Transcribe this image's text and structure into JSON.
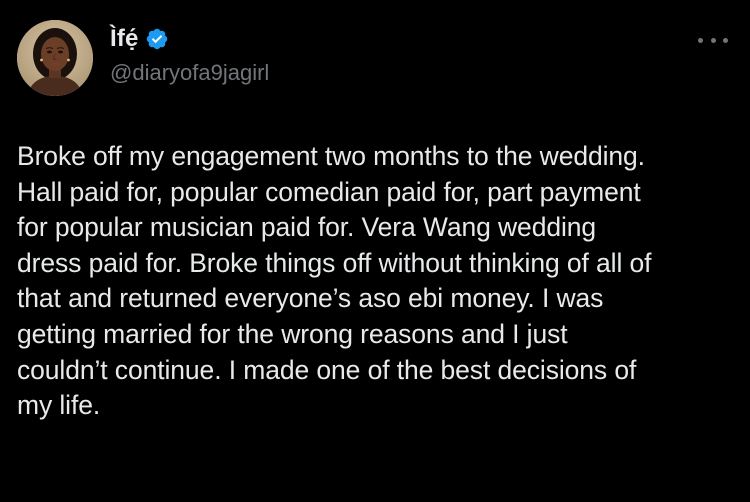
{
  "author": {
    "display_name": "Ìfẹ́",
    "handle": "@diaryofa9jagirl",
    "avatar_icon": "profile-photo",
    "verified_icon": "verified-badge-icon",
    "verified_color": "#1d9bf0"
  },
  "menu": {
    "icon": "more-options-icon"
  },
  "tweet": {
    "text": "Broke off my engagement two months to the wedding.\nHall paid for, popular comedian paid for, part payment\nfor popular musician paid for. Vera Wang wedding\ndress paid for. Broke things off without thinking of all of\nthat and returned everyone’s aso ebi money. I was\ngetting married for the wrong reasons and I just\ncouldn’t continue. I made one of the best decisions of\nmy life."
  },
  "colors": {
    "background": "#000000",
    "primary_text": "#e7e9ea",
    "secondary_text": "#71767b",
    "accent": "#1d9bf0"
  }
}
